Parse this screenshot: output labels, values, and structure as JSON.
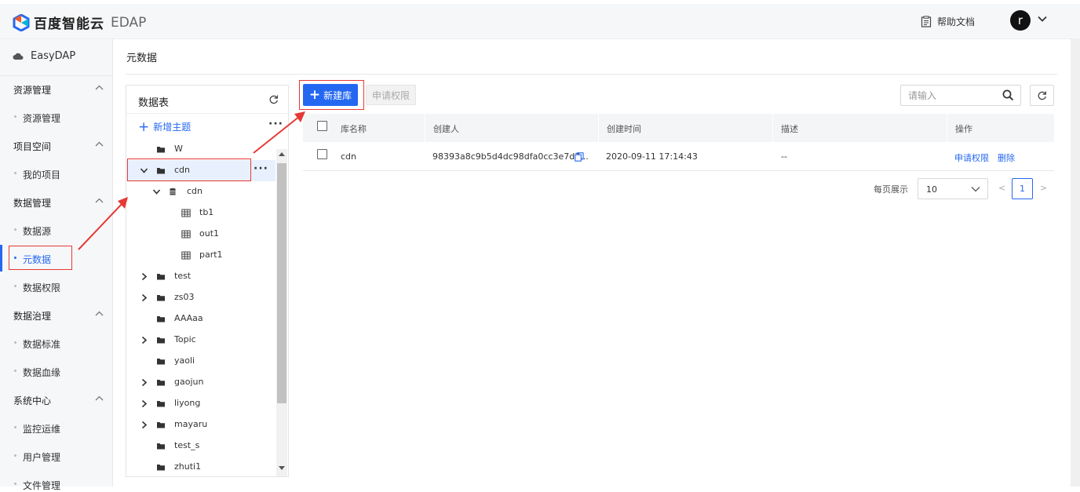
{
  "header": {
    "brand": "百度智能云",
    "product": "EDAP",
    "help": "帮助文档",
    "user_initial": "r"
  },
  "sidebar": {
    "app_name": "EasyDAP",
    "groups": [
      {
        "label": "资源管理",
        "items": [
          "资源管理"
        ]
      },
      {
        "label": "项目空间",
        "items": [
          "我的项目"
        ]
      },
      {
        "label": "数据管理",
        "items": [
          "数据源",
          "元数据",
          "数据权限"
        ]
      },
      {
        "label": "数据治理",
        "items": [
          "数据标准",
          "数据血缘"
        ]
      },
      {
        "label": "系统中心",
        "items": [
          "监控运维",
          "用户管理",
          "文件管理"
        ]
      }
    ],
    "active_item": "元数据"
  },
  "breadcrumb": "元数据",
  "tree": {
    "title": "数据表",
    "add_label": "新增主题",
    "nodes": [
      {
        "label": "W",
        "level": 0,
        "expand": "none",
        "icon": "folder-icon"
      },
      {
        "label": "cdn",
        "level": 0,
        "expand": "open",
        "icon": "folder-icon",
        "selected": true
      },
      {
        "label": "cdn",
        "level": 1,
        "expand": "open",
        "icon": "database-icon"
      },
      {
        "label": "tb1",
        "level": 2,
        "expand": "none",
        "icon": "table-icon"
      },
      {
        "label": "out1",
        "level": 2,
        "expand": "none",
        "icon": "table-icon"
      },
      {
        "label": "part1",
        "level": 2,
        "expand": "none",
        "icon": "table-icon"
      },
      {
        "label": "test",
        "level": 0,
        "expand": "closed",
        "icon": "folder-icon"
      },
      {
        "label": "zs03",
        "level": 0,
        "expand": "closed",
        "icon": "folder-icon"
      },
      {
        "label": "AAAaa",
        "level": 0,
        "expand": "none",
        "icon": "folder-icon"
      },
      {
        "label": "Topic",
        "level": 0,
        "expand": "closed",
        "icon": "folder-icon"
      },
      {
        "label": "yaoli",
        "level": 0,
        "expand": "none",
        "icon": "folder-icon"
      },
      {
        "label": "gaojun",
        "level": 0,
        "expand": "closed",
        "icon": "folder-icon"
      },
      {
        "label": "liyong",
        "level": 0,
        "expand": "closed",
        "icon": "folder-icon"
      },
      {
        "label": "mayaru",
        "level": 0,
        "expand": "closed",
        "icon": "folder-icon"
      },
      {
        "label": "test_s",
        "level": 0,
        "expand": "none",
        "icon": "folder-icon"
      },
      {
        "label": "zhuti1",
        "level": 0,
        "expand": "none",
        "icon": "folder-icon"
      }
    ]
  },
  "toolbar": {
    "new_db": "新建库",
    "request_perm": "申请权限",
    "search_placeholder": "请输入"
  },
  "table": {
    "headers": [
      "库名称",
      "创建人",
      "创建时间",
      "描述",
      "操作"
    ],
    "rows": [
      {
        "name": "cdn",
        "creator": "98393a8c9b5d4dc98dfa0cc3e7d7...",
        "created": "2020-09-11 17:14:43",
        "desc": "--",
        "actions": [
          "申请权限",
          "删除"
        ]
      }
    ]
  },
  "pagination": {
    "per_page_label": "每页展示",
    "page_size": "10",
    "prev": "<",
    "current": "1",
    "next": ">"
  },
  "colors": {
    "accent": "#2468f2",
    "annotation": "#e53935"
  }
}
